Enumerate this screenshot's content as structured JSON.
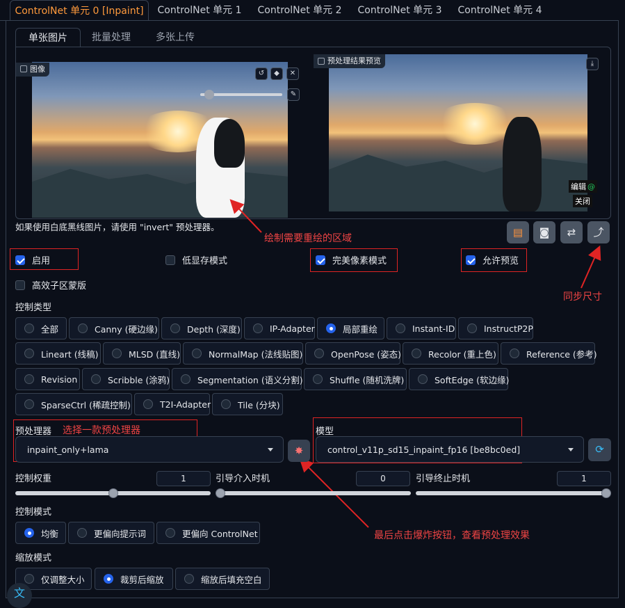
{
  "top_tabs": [
    "ControlNet 单元 0 [Inpaint]",
    "ControlNet 单元 1",
    "ControlNet 单元 2",
    "ControlNet 单元 3",
    "ControlNet 单元 4"
  ],
  "sub_tabs": [
    "单张图片",
    "批量处理",
    "多张上传"
  ],
  "image_panel": {
    "label": "图像"
  },
  "preview_panel": {
    "label": "预处理结果预览",
    "edit_label": "编辑",
    "close_label": "关闭"
  },
  "note": "如果使用白底黑线图片，请使用 \"invert\" 预处理器。",
  "annotations": {
    "draw_area": "绘制需要重绘的区域",
    "sync_size": "同步尺寸",
    "choose_preprocessor": "选择一款预处理器",
    "click_explode": "最后点击爆炸按钮，查看预处理效果"
  },
  "checkboxes": {
    "enable": {
      "label": "启用",
      "checked": true
    },
    "low_vram": {
      "label": "低显存模式",
      "checked": false
    },
    "pixel_perfect": {
      "label": "完美像素模式",
      "checked": true
    },
    "allow_preview": {
      "label": "允许预览",
      "checked": true
    },
    "efficient_mask": {
      "label": "高效子区蒙版",
      "checked": false
    }
  },
  "control_type": {
    "label": "控制类型",
    "options": [
      "全部",
      "Canny (硬边缘)",
      "Depth (深度)",
      "IP-Adapter",
      "局部重绘",
      "Instant-ID",
      "InstructP2P",
      "Lineart (线稿)",
      "MLSD (直线)",
      "NormalMap (法线贴图)",
      "OpenPose (姿态)",
      "Recolor (重上色)",
      "Reference (参考)",
      "Revision",
      "Scribble (涂鸦)",
      "Segmentation (语义分割)",
      "Shuffle (随机洗牌)",
      "SoftEdge (软边缘)",
      "SparseCtrl (稀疏控制)",
      "T2I-Adapter",
      "Tile (分块)"
    ],
    "selected": "局部重绘"
  },
  "preprocessor": {
    "label": "预处理器",
    "value": "inpaint_only+lama"
  },
  "model": {
    "label": "模型",
    "value": "control_v11p_sd15_inpaint_fp16 [be8bc0ed]"
  },
  "sliders": {
    "weight": {
      "label": "控制权重",
      "value": "1",
      "fraction": 0.5
    },
    "start": {
      "label": "引导介入时机",
      "value": "0",
      "fraction": 0.0
    },
    "end": {
      "label": "引导终止时机",
      "value": "1",
      "fraction": 1.0
    }
  },
  "control_mode": {
    "label": "控制模式",
    "options": [
      "均衡",
      "更偏向提示词",
      "更偏向 ControlNet"
    ],
    "selected": "均衡"
  },
  "resize_mode": {
    "label": "缩放模式",
    "options": [
      "仅调整大小",
      "裁剪后缩放",
      "缩放后填充空白"
    ],
    "selected": "裁剪后缩放"
  },
  "colors": {
    "accent": "#ff9a3c",
    "annotation_red": "#e02424",
    "checked_blue": "#2563eb"
  }
}
